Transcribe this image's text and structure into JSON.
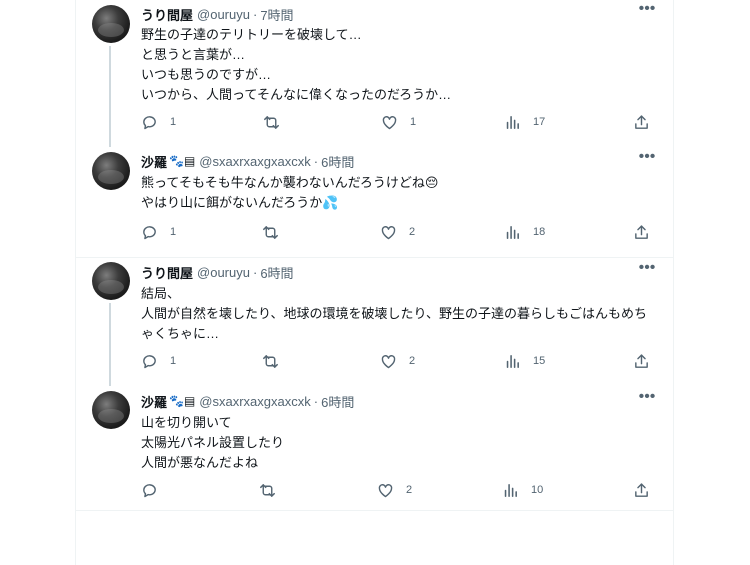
{
  "tweets": [
    {
      "name": "うり間屋",
      "handle": "@ouruyu",
      "dot": "·",
      "time": "7時間",
      "lines": [
        "野生の子達のテリトリーを破壊して…",
        "と思うと言葉が…",
        "いつも思うのですが…",
        "いつから、人間ってそんなに偉くなったのだろうか…"
      ],
      "replies": "1",
      "retweets": "",
      "likes": "1",
      "views": "17"
    },
    {
      "name": "沙羅",
      "name_emoji": "🐾▤",
      "handle": "@sxaxrxaxgxaxcxk",
      "dot": "·",
      "time": "6時間",
      "lines": [
        "熊ってそもそも牛なんか襲わないんだろうけどね😔",
        "やはり山に餌がないんだろうか💦"
      ],
      "replies": "1",
      "retweets": "",
      "likes": "2",
      "views": "18"
    },
    {
      "name": "うり間屋",
      "handle": "@ouruyu",
      "dot": "·",
      "time": "6時間",
      "lines": [
        "結局、",
        "人間が自然を壊したり、地球の環境を破壊したり、野生の子達の暮らしもごはんもめち",
        "ゃくちゃに…"
      ],
      "replies": "1",
      "retweets": "",
      "likes": "2",
      "views": "15"
    },
    {
      "name": "沙羅",
      "name_emoji": "🐾▤",
      "handle": "@sxaxrxaxgxaxcxk",
      "dot": "·",
      "time": "6時間",
      "lines": [
        "山を切り開いて",
        "太陽光パネル設置したり",
        "人間が悪なんだよね"
      ],
      "replies": "",
      "retweets": "",
      "likes": "2",
      "views": "10"
    }
  ],
  "more_glyph": "•••",
  "icons": {
    "reply": "reply-icon",
    "retweet": "retweet-icon",
    "like": "heart-icon",
    "views": "views-chart-icon",
    "share": "share-icon",
    "more": "more-dots-icon"
  }
}
